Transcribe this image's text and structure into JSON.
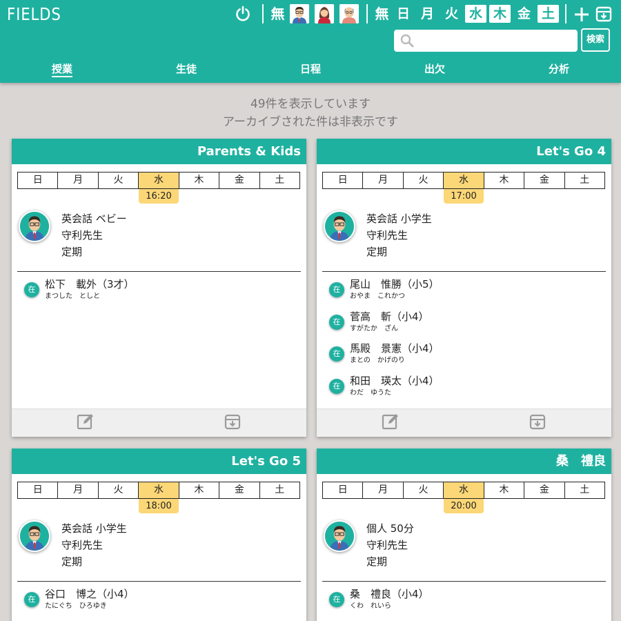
{
  "app": {
    "logo": "FIELDS"
  },
  "toolbar": {
    "none_label": "無",
    "days_none_label": "無",
    "days": [
      {
        "label": "日",
        "active": false
      },
      {
        "label": "月",
        "active": false
      },
      {
        "label": "火",
        "active": false
      },
      {
        "label": "水",
        "active": true
      },
      {
        "label": "木",
        "active": true
      },
      {
        "label": "金",
        "active": false
      },
      {
        "label": "土",
        "active": true
      }
    ],
    "plus_label": "+"
  },
  "search": {
    "placeholder": "",
    "button_label": "検索"
  },
  "nav": {
    "items": [
      "授業",
      "生徒",
      "日程",
      "出欠",
      "分析"
    ],
    "active": "授業"
  },
  "info": {
    "line1": "49件を表示しています",
    "line2": "アーカイブされた件は非表示です"
  },
  "weekdays": [
    "日",
    "月",
    "火",
    "水",
    "木",
    "金",
    "土"
  ],
  "cards": [
    {
      "title": "Parents & Kids",
      "time": "16:20",
      "course": "英会話 ベビー",
      "teacher": "守利先生",
      "kind": "定期",
      "students": [
        {
          "badge": "在",
          "name": "松下　載外（3才）",
          "kana": "まつした　としと"
        }
      ]
    },
    {
      "title": "Let's Go 4",
      "time": "17:00",
      "course": "英会話 小学生",
      "teacher": "守利先生",
      "kind": "定期",
      "students": [
        {
          "badge": "在",
          "name": "尾山　惟勝（小5）",
          "kana": "おやま　これかつ"
        },
        {
          "badge": "在",
          "name": "菅高　斬（小4）",
          "kana": "すがたか　ざん"
        },
        {
          "badge": "在",
          "name": "馬殿　景憲（小4）",
          "kana": "まとの　かげのり"
        },
        {
          "badge": "在",
          "name": "和田　瑛太（小4）",
          "kana": "わだ　ゆうた"
        }
      ]
    },
    {
      "title": "Let's Go 5",
      "time": "18:00",
      "course": "英会話 小学生",
      "teacher": "守利先生",
      "kind": "定期",
      "students": [
        {
          "badge": "在",
          "name": "谷口　博之（小4）",
          "kana": "たにぐち　ひろゆき"
        }
      ]
    },
    {
      "title": "桑　禮良",
      "time": "20:00",
      "course": "個人 50分",
      "teacher": "守利先生",
      "kind": "定期",
      "students": [
        {
          "badge": "在",
          "name": "桑　禮良（小4）",
          "kana": "くわ　れいら"
        }
      ]
    }
  ],
  "colors": {
    "accent": "#1fb1a0",
    "highlight": "#fcd777",
    "background": "#d9d6d4"
  },
  "icons": [
    "power-icon",
    "teacher-male-avatar",
    "teacher-female-avatar",
    "elder-avatar",
    "plus-icon",
    "archive-icon",
    "search-icon",
    "edit-icon"
  ]
}
